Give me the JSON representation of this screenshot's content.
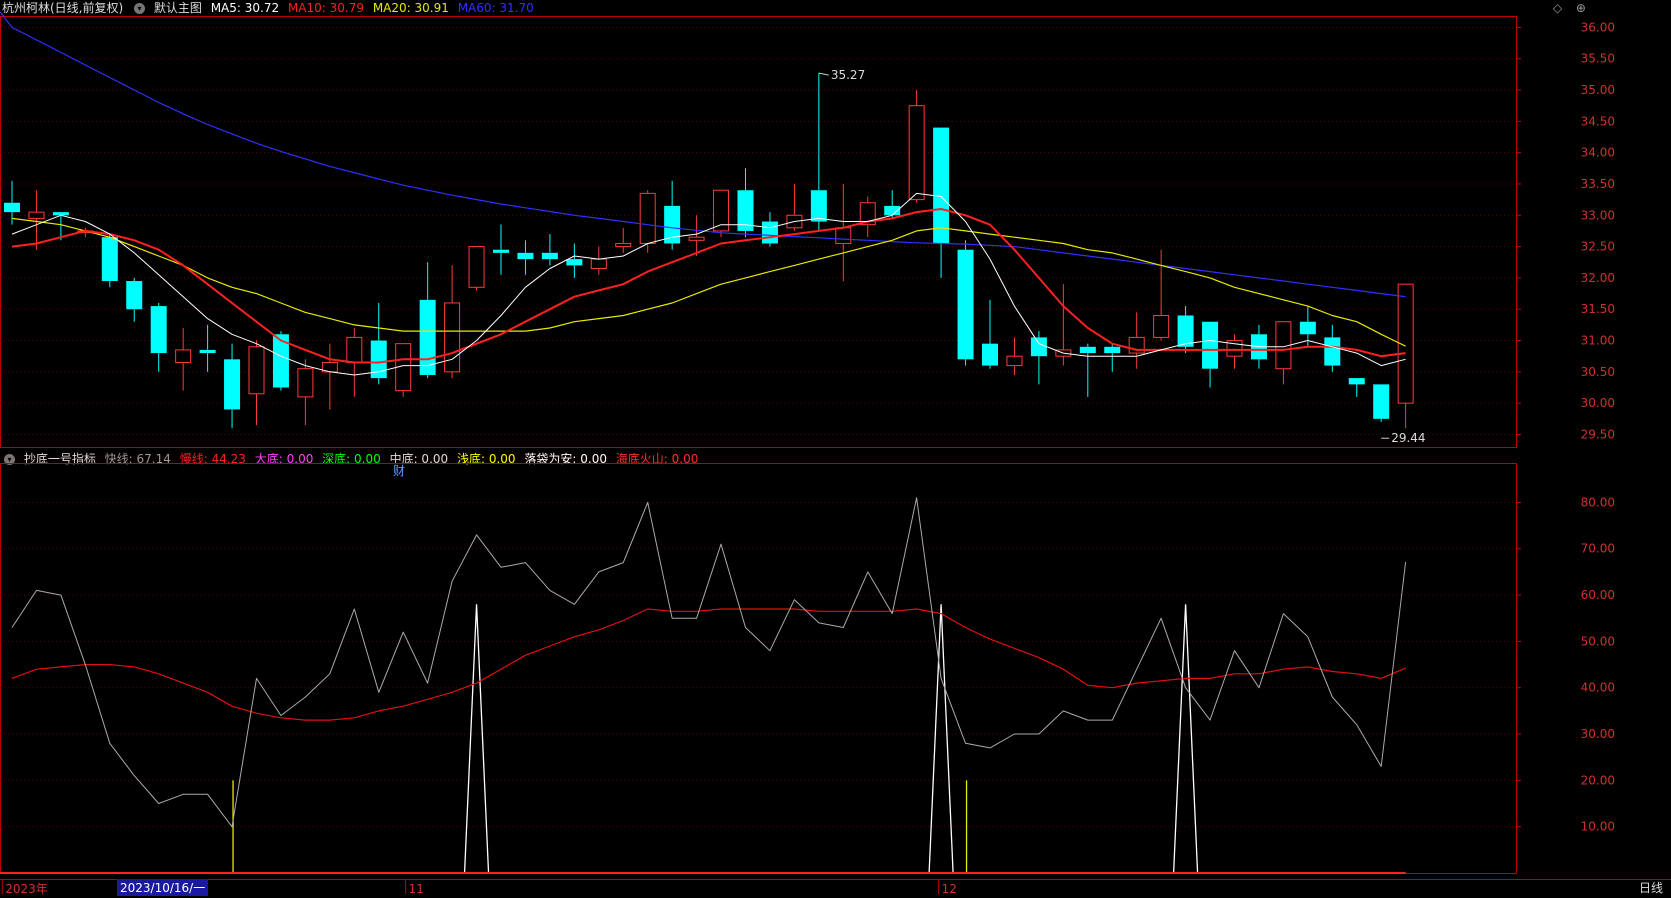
{
  "main_legend": {
    "title": "杭州柯林(日线,前复权)",
    "chart_name": "默认主图",
    "ma5": "MA5: 30.72",
    "ma10": "MA10: 30.79",
    "ma20": "MA20: 30.91",
    "ma60": "MA60: 31.70"
  },
  "sub_legend": {
    "title": "抄底一号指标",
    "fast": "快线: 67.14",
    "slow": "慢线: 44.23",
    "big_bottom": "大底: 0.00",
    "deep_bottom": "深底: 0.00",
    "mid_bottom": "中底: 0.00",
    "shallow_bottom": "浅底: 0.00",
    "safe_landing": "落袋为安: 0.00",
    "volcano": "海底火山: 0.00"
  },
  "annotations": {
    "high_label": "35.27",
    "low_label": "29.44",
    "fin_marker": "财"
  },
  "axis": {
    "price_ticks": [
      "36.00",
      "35.50",
      "35.00",
      "34.50",
      "34.00",
      "33.50",
      "33.00",
      "32.50",
      "32.00",
      "31.50",
      "31.00",
      "30.50",
      "30.00",
      "29.50"
    ],
    "indicator_ticks": [
      "80.00",
      "70.00",
      "60.00",
      "50.00",
      "40.00",
      "30.00",
      "20.00",
      "10.00"
    ],
    "date_labels": [
      "2023年",
      "11",
      "12"
    ],
    "selected_date": "2023/10/16/一",
    "period_button": "日线"
  },
  "icons": {
    "top_right": "◇ ⊕"
  },
  "colors": {
    "up": "#ff3b3b",
    "down": "#00ffff",
    "ma5": "#ffffff",
    "ma10": "#ff2020",
    "ma20": "#e8e800",
    "ma60": "#3030ff"
  },
  "chart_data": {
    "type": "candlestick",
    "candles": [
      [
        33.2,
        33.05,
        33.55,
        32.85
      ],
      [
        32.95,
        33.05,
        33.4,
        32.45
      ],
      [
        33.05,
        33.0,
        33.05,
        32.6
      ],
      [
        32.75,
        32.75,
        32.8,
        32.65
      ],
      [
        32.65,
        31.95,
        32.7,
        31.85
      ],
      [
        31.95,
        31.5,
        32.0,
        31.3
      ],
      [
        31.55,
        30.8,
        31.6,
        30.5
      ],
      [
        30.65,
        30.85,
        31.2,
        30.2
      ],
      [
        30.85,
        30.8,
        31.25,
        30.5
      ],
      [
        30.7,
        29.9,
        30.95,
        29.6
      ],
      [
        30.15,
        30.9,
        31.0,
        29.65
      ],
      [
        31.1,
        30.25,
        31.15,
        30.2
      ],
      [
        30.1,
        30.55,
        30.7,
        29.65
      ],
      [
        30.5,
        30.65,
        30.95,
        29.9
      ],
      [
        30.65,
        31.05,
        31.2,
        30.1
      ],
      [
        31.0,
        30.4,
        31.6,
        30.3
      ],
      [
        30.2,
        30.95,
        30.95,
        30.1
      ],
      [
        31.65,
        30.45,
        32.25,
        30.4
      ],
      [
        30.5,
        31.6,
        32.2,
        30.4
      ],
      [
        31.85,
        32.5,
        32.5,
        31.8
      ],
      [
        32.45,
        32.4,
        32.85,
        32.05
      ],
      [
        32.4,
        32.3,
        32.6,
        32.05
      ],
      [
        32.4,
        32.3,
        32.7,
        32.2
      ],
      [
        32.3,
        32.2,
        32.55,
        32.0
      ],
      [
        32.15,
        32.3,
        32.5,
        32.05
      ],
      [
        32.5,
        32.55,
        32.8,
        32.4
      ],
      [
        32.55,
        33.35,
        33.4,
        32.4
      ],
      [
        33.15,
        32.55,
        33.55,
        32.45
      ],
      [
        32.6,
        32.65,
        33.0,
        32.35
      ],
      [
        32.75,
        33.4,
        33.4,
        32.65
      ],
      [
        33.4,
        32.75,
        33.75,
        32.65
      ],
      [
        32.9,
        32.55,
        33.05,
        32.5
      ],
      [
        32.8,
        33.0,
        33.5,
        32.75
      ],
      [
        33.4,
        32.9,
        35.27,
        32.75
      ],
      [
        32.55,
        32.8,
        33.5,
        31.95
      ],
      [
        32.85,
        33.2,
        33.3,
        32.65
      ],
      [
        33.15,
        33.0,
        33.4,
        32.95
      ],
      [
        33.25,
        34.75,
        35.0,
        33.2
      ],
      [
        34.4,
        32.55,
        34.4,
        32.0
      ],
      [
        32.45,
        30.7,
        32.6,
        30.6
      ],
      [
        30.95,
        30.6,
        31.65,
        30.55
      ],
      [
        30.6,
        30.75,
        31.05,
        30.45
      ],
      [
        31.05,
        30.75,
        31.15,
        30.3
      ],
      [
        30.75,
        30.85,
        31.9,
        30.6
      ],
      [
        30.9,
        30.8,
        30.95,
        30.1
      ],
      [
        30.9,
        30.8,
        30.95,
        30.5
      ],
      [
        30.8,
        31.05,
        31.45,
        30.55
      ],
      [
        31.05,
        31.4,
        32.45,
        31.0
      ],
      [
        31.4,
        30.9,
        31.55,
        30.8
      ],
      [
        31.3,
        30.55,
        31.3,
        30.25
      ],
      [
        30.75,
        31.0,
        31.1,
        30.55
      ],
      [
        31.1,
        30.7,
        31.25,
        30.55
      ],
      [
        30.55,
        31.3,
        31.3,
        30.3
      ],
      [
        31.3,
        31.1,
        31.55,
        30.9
      ],
      [
        31.05,
        30.6,
        31.25,
        30.5
      ],
      [
        30.4,
        30.3,
        30.4,
        30.1
      ],
      [
        30.3,
        29.75,
        30.3,
        29.7
      ],
      [
        30.0,
        31.9,
        31.9,
        29.6
      ]
    ],
    "ma5": [
      32.7,
      32.85,
      33.0,
      32.9,
      32.7,
      32.4,
      32.05,
      31.7,
      31.35,
      31.1,
      30.95,
      30.75,
      30.6,
      30.5,
      30.45,
      30.5,
      30.6,
      30.6,
      30.7,
      31.0,
      31.4,
      31.85,
      32.15,
      32.35,
      32.3,
      32.35,
      32.55,
      32.65,
      32.7,
      32.85,
      32.85,
      32.8,
      32.9,
      32.95,
      32.9,
      32.9,
      33.0,
      33.35,
      33.3,
      32.9,
      32.3,
      31.55,
      30.95,
      30.8,
      30.75,
      30.75,
      30.75,
      30.85,
      30.95,
      31.0,
      30.95,
      30.9,
      30.9,
      31.0,
      30.9,
      30.8,
      30.6,
      30.7
    ],
    "ma10": [
      32.5,
      32.55,
      32.65,
      32.75,
      32.7,
      32.6,
      32.45,
      32.2,
      31.9,
      31.6,
      31.3,
      31.0,
      30.85,
      30.7,
      30.65,
      30.65,
      30.7,
      30.7,
      30.8,
      30.95,
      31.1,
      31.3,
      31.5,
      31.7,
      31.8,
      31.9,
      32.1,
      32.25,
      32.4,
      32.55,
      32.6,
      32.65,
      32.7,
      32.75,
      32.8,
      32.9,
      32.95,
      33.05,
      33.1,
      33.0,
      32.85,
      32.45,
      32.0,
      31.55,
      31.2,
      30.95,
      30.85,
      30.85,
      30.85,
      30.85,
      30.85,
      30.85,
      30.85,
      30.9,
      30.9,
      30.85,
      30.75,
      30.8
    ],
    "ma20": [
      32.95,
      32.9,
      32.85,
      32.75,
      32.65,
      32.5,
      32.35,
      32.2,
      32.0,
      31.85,
      31.75,
      31.6,
      31.45,
      31.35,
      31.25,
      31.2,
      31.15,
      31.15,
      31.15,
      31.15,
      31.15,
      31.15,
      31.2,
      31.3,
      31.35,
      31.4,
      31.5,
      31.6,
      31.75,
      31.9,
      32.0,
      32.1,
      32.2,
      32.3,
      32.4,
      32.5,
      32.6,
      32.75,
      32.8,
      32.75,
      32.7,
      32.65,
      32.6,
      32.55,
      32.45,
      32.4,
      32.3,
      32.2,
      32.1,
      32.0,
      31.85,
      31.75,
      31.65,
      31.55,
      31.4,
      31.3,
      31.1,
      30.91
    ],
    "ma60": [
      36.0,
      35.8,
      35.6,
      35.4,
      35.2,
      35.0,
      34.8,
      34.62,
      34.45,
      34.3,
      34.15,
      34.02,
      33.9,
      33.78,
      33.68,
      33.58,
      33.48,
      33.4,
      33.32,
      33.25,
      33.18,
      33.12,
      33.06,
      33.0,
      32.95,
      32.9,
      32.85,
      32.8,
      32.76,
      32.72,
      32.7,
      32.68,
      32.66,
      32.64,
      32.62,
      32.6,
      32.58,
      32.56,
      32.55,
      32.54,
      32.52,
      32.5,
      32.45,
      32.4,
      32.35,
      32.3,
      32.25,
      32.2,
      32.15,
      32.1,
      32.05,
      32.0,
      31.95,
      31.9,
      31.85,
      31.8,
      31.75,
      31.7
    ],
    "fast": [
      53,
      61,
      60,
      45,
      28,
      21,
      15,
      17,
      17,
      10,
      42,
      34,
      38,
      43,
      57,
      39,
      52,
      41,
      63,
      73,
      66,
      67,
      61,
      58,
      65,
      67,
      80,
      55,
      55,
      71,
      53,
      48,
      59,
      54,
      53,
      65,
      56,
      81,
      42,
      28,
      27,
      30,
      30,
      35,
      33,
      33,
      44,
      55,
      40,
      33,
      48,
      40,
      56,
      51,
      38,
      32,
      23,
      67.14
    ],
    "slow": [
      42,
      44,
      44.5,
      45,
      45,
      44.5,
      43,
      41,
      39,
      36,
      34.5,
      33.5,
      33,
      33,
      33.5,
      35,
      36,
      37.5,
      39,
      41,
      44,
      47,
      49,
      51,
      52.5,
      54.5,
      57,
      56.5,
      56.5,
      57,
      57,
      57,
      57,
      56.5,
      56.5,
      56.5,
      56.5,
      57,
      56,
      53,
      50.5,
      48.5,
      46.5,
      44,
      40.5,
      40,
      41,
      41.5,
      42,
      42,
      43,
      43,
      44,
      44.5,
      43.5,
      43,
      42,
      44.23
    ],
    "bottom_signals": [
      {
        "index": 19,
        "value": 58
      },
      {
        "index": 38,
        "value": 58
      },
      {
        "index": 48,
        "value": 58
      }
    ],
    "yellow_marks": [
      {
        "index": 9,
        "value": 20
      },
      {
        "index": 39,
        "value": 20
      }
    ],
    "price_ylim": [
      29.3,
      36.15
    ],
    "indicator_ylim": [
      0,
      87
    ]
  }
}
